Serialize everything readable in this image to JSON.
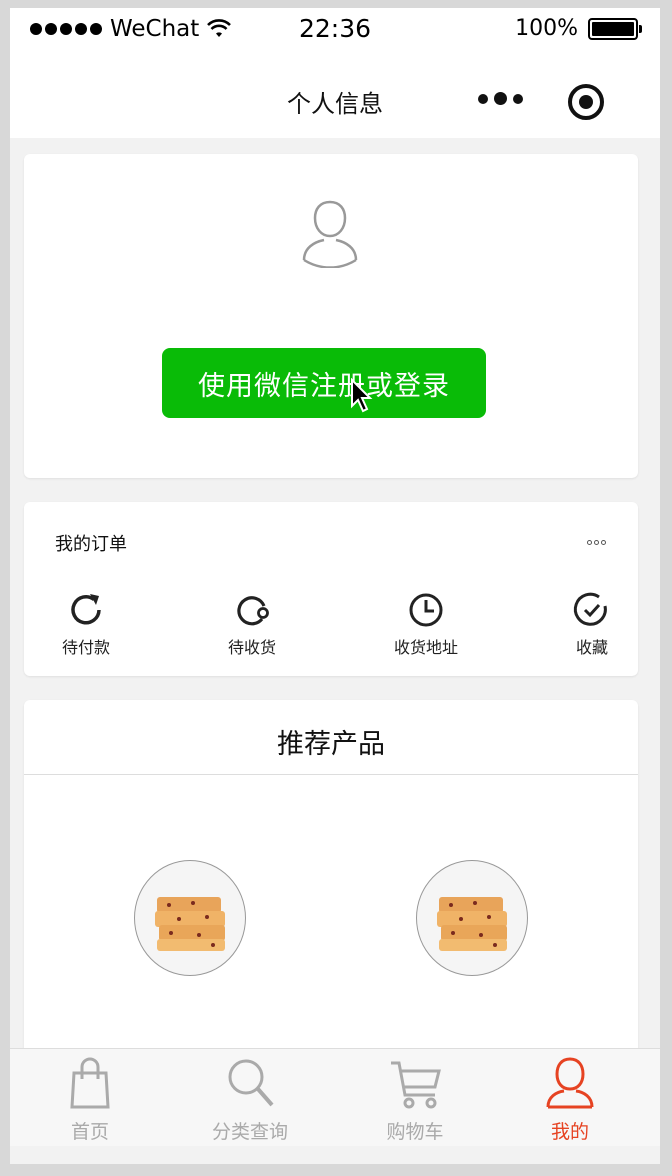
{
  "status_bar": {
    "carrier": "WeChat",
    "time": "22:36",
    "battery": "100%"
  },
  "nav": {
    "title": "个人信息"
  },
  "login": {
    "button_label": "使用微信注册或登录"
  },
  "orders": {
    "title": "我的订单",
    "items": [
      {
        "label": "待付款",
        "icon": "refresh-icon"
      },
      {
        "label": "待收货",
        "icon": "receive-icon"
      },
      {
        "label": "收货地址",
        "icon": "clock-icon"
      },
      {
        "label": "收藏",
        "icon": "check-circle-icon"
      }
    ]
  },
  "recommend": {
    "title": "推荐产品"
  },
  "tabbar": {
    "items": [
      {
        "label": "首页",
        "icon": "shopping-bag-icon"
      },
      {
        "label": "分类查询",
        "icon": "search-icon"
      },
      {
        "label": "购物车",
        "icon": "cart-icon"
      },
      {
        "label": "我的",
        "icon": "user-icon",
        "active": true
      }
    ],
    "active_color": "#e64322",
    "inactive_color": "#aaaaaa"
  },
  "colors": {
    "primary_button": "#09bb07",
    "background": "#f2f2f2"
  }
}
